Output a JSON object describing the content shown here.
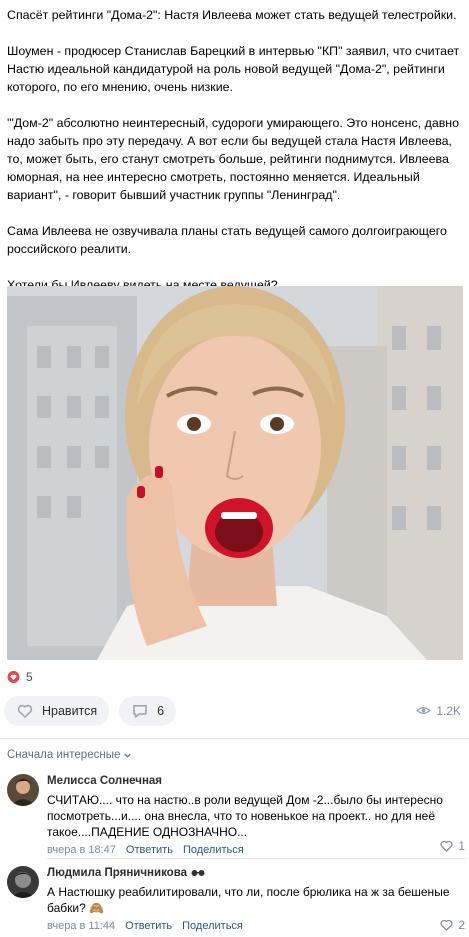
{
  "post": {
    "paragraphs": [
      "Спасёт рейтинги \"Дома-2\": Настя Ивлеева может стать ведущей телестройки.",
      "Шоумен - продюсер Станислав Барецкий в интервью \"КП\" заявил, что считает Настю идеальной кандидатурой на роль новой ведущей \"Дома-2\", рейтинги которого, по его мнению, очень низкие.",
      "'\"Дом-2\" абсолютно неинтересный, судороги умирающего. Это нонсенс, давно надо забыть про эту передачу. А вот если бы ведущей стала Настя Ивлеева, то, может быть, его станут смотреть больше, рейтинги поднимутся. Ивлеева юморная, на нее интересно смотреть, постоянно меняется. Идеальный вариант\", - говорит бывший участник группы \"Ленинград\".",
      "Сама Ивлеева не озвучивала планы стать ведущей самого долгоиграющего российского реалити.",
      "Хотели бы Ивлееву видеть на месте ведущей?"
    ]
  },
  "reactions": {
    "count": "5"
  },
  "actions": {
    "like_label": "Нравится",
    "comments_count": "6",
    "views": "1.2K"
  },
  "comments_sort": {
    "label": "Сначала интересные"
  },
  "comments": [
    {
      "author": "Мелисса Солнечная",
      "text": "СЧИТАЮ.... что на настю..в роли ведущей Дом -2...было бы интересно посмотреть...и.... она внесла, что то новенькое на проект.. но для неё такое....ПАДЕНИЕ ОДНОЗНАЧНО...",
      "time": "вчера в 18:47",
      "reply": "Ответить",
      "share": "Поделиться",
      "likes": "1"
    },
    {
      "author": "Людмила Пряничникова",
      "text": "А Настюшку реабилитировали, что ли, после брюлика на ж за бешеные бабки? 🙈",
      "time": "вчера в 11:44",
      "reply": "Ответить",
      "share": "Поделиться",
      "likes": "2"
    }
  ],
  "colors": {
    "reaction": "#e64646",
    "link": "#2a5885",
    "muted": "#818c99",
    "pill": "#f0f2f5"
  }
}
